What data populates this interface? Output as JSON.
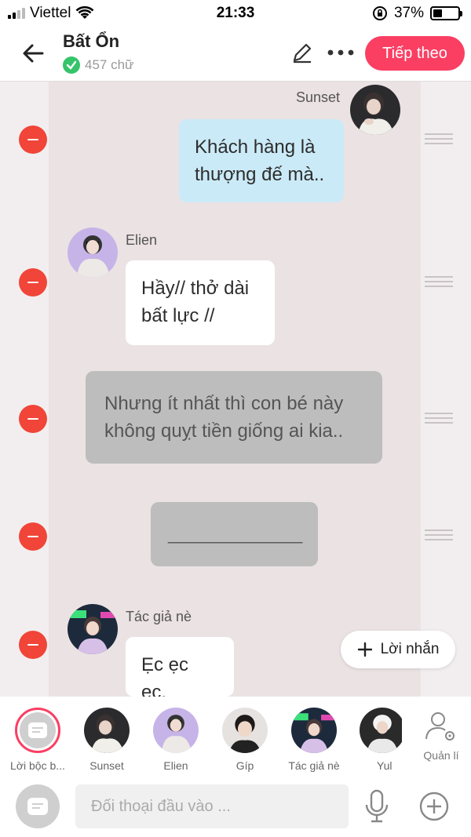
{
  "status_bar": {
    "carrier": "Viettel",
    "time": "21:33",
    "battery": "37%"
  },
  "header": {
    "title": "Bất Ổn",
    "word_count": "457 chữ",
    "next_label": "Tiếp theo"
  },
  "messages": [
    {
      "speaker": "Sunset",
      "text": "Khách hàng là thượng đế mà..",
      "style": "blue"
    },
    {
      "speaker": "Elien",
      "text": "Hầy// thở dài bất lực //",
      "style": "white"
    },
    {
      "speaker": "",
      "text": "Nhưng ít nhất thì con bé này không quỵt tiền giống ai kia..",
      "style": "narration"
    },
    {
      "speaker": "",
      "text": "______________",
      "style": "narration"
    },
    {
      "speaker": "Tác giả nè",
      "text": "Ẹc ẹc ẹc.",
      "style": "white"
    }
  ],
  "add_message_label": "Lời nhắn",
  "characters": [
    {
      "label": "Lời bộc b..."
    },
    {
      "label": "Sunset"
    },
    {
      "label": "Elien"
    },
    {
      "label": "Gíp"
    },
    {
      "label": "Tác giả nè"
    },
    {
      "label": "Yul"
    }
  ],
  "manage_label": "Quản lí",
  "input": {
    "placeholder": "Đối thoại đầu vào ..."
  },
  "colors": {
    "accent": "#fa3f63",
    "delete": "#f04538",
    "bubble_blue": "#cbeaf7",
    "bubble_gray": "#bdbdbd",
    "verified": "#35c46a"
  }
}
